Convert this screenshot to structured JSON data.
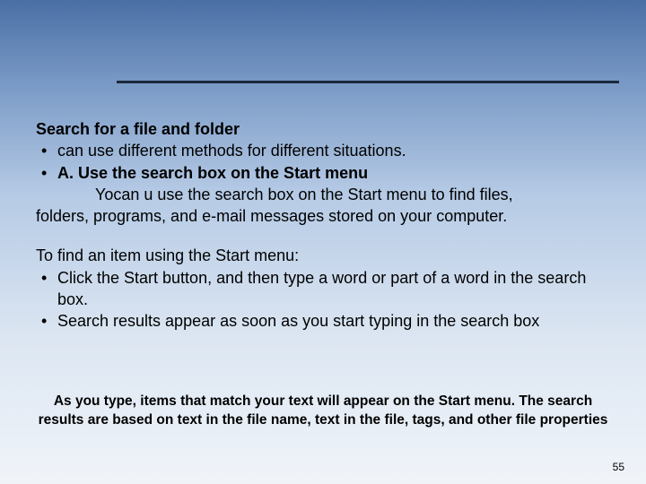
{
  "section_title": "Search for a file and folder",
  "bullets_intro": [
    "can use different methods for different situations.",
    "A. Use the search box on the Start menu"
  ],
  "sub_text_line1": "Yocan u use the search box on the Start menu to find files,",
  "sub_text_line2": "folders, programs, and e-mail messages stored on your computer.",
  "para2_heading": "To find an item using the Start menu:",
  "para2_bullets": [
    "Click the Start button, and then type a word or part of a word in the search box.",
    "Search results appear as soon as you start typing in the search box"
  ],
  "footnote": "As you type, items that match your text will appear on the Start menu. The search results are based on text in the file name, text in the file, tags, and other file properties",
  "page_number": "55"
}
